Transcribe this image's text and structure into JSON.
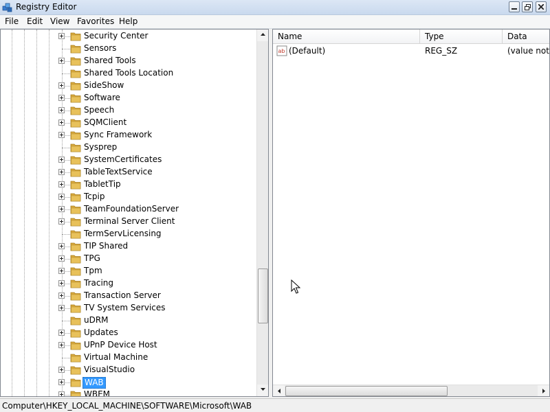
{
  "window": {
    "title": "Registry Editor",
    "icon": "registry-editor-icon"
  },
  "menu": {
    "items": [
      "File",
      "Edit",
      "View",
      "Favorites",
      "Help"
    ]
  },
  "tree": {
    "items": [
      {
        "label": "Security Center",
        "expandable": true
      },
      {
        "label": "Sensors",
        "expandable": false
      },
      {
        "label": "Shared Tools",
        "expandable": true
      },
      {
        "label": "Shared Tools Location",
        "expandable": false
      },
      {
        "label": "SideShow",
        "expandable": true
      },
      {
        "label": "Software",
        "expandable": true
      },
      {
        "label": "Speech",
        "expandable": true
      },
      {
        "label": "SQMClient",
        "expandable": true
      },
      {
        "label": "Sync Framework",
        "expandable": true
      },
      {
        "label": "Sysprep",
        "expandable": false
      },
      {
        "label": "SystemCertificates",
        "expandable": true
      },
      {
        "label": "TableTextService",
        "expandable": true
      },
      {
        "label": "TabletTip",
        "expandable": true
      },
      {
        "label": "Tcpip",
        "expandable": true
      },
      {
        "label": "TeamFoundationServer",
        "expandable": true
      },
      {
        "label": "Terminal Server Client",
        "expandable": true
      },
      {
        "label": "TermServLicensing",
        "expandable": false
      },
      {
        "label": "TIP Shared",
        "expandable": true
      },
      {
        "label": "TPG",
        "expandable": true
      },
      {
        "label": "Tpm",
        "expandable": true
      },
      {
        "label": "Tracing",
        "expandable": true
      },
      {
        "label": "Transaction Server",
        "expandable": true
      },
      {
        "label": "TV System Services",
        "expandable": true
      },
      {
        "label": "uDRM",
        "expandable": false
      },
      {
        "label": "Updates",
        "expandable": true
      },
      {
        "label": "UPnP Device Host",
        "expandable": true
      },
      {
        "label": "Virtual Machine",
        "expandable": false
      },
      {
        "label": "VisualStudio",
        "expandable": true
      },
      {
        "label": "WAB",
        "expandable": true,
        "selected": true
      },
      {
        "label": "WBEM",
        "expandable": true
      }
    ]
  },
  "list": {
    "columns": {
      "name": "Name",
      "type": "Type",
      "data": "Data"
    },
    "rows": [
      {
        "name": "(Default)",
        "type": "REG_SZ",
        "data": "(value not set)",
        "icon": "string-value-icon"
      }
    ]
  },
  "statusbar": {
    "path": "Computer\\HKEY_LOCAL_MACHINE\\SOFTWARE\\Microsoft\\WAB"
  },
  "colors": {
    "selection": "#3399ff",
    "folder": "#e8c15a",
    "titlebar": "#dce7f5"
  }
}
